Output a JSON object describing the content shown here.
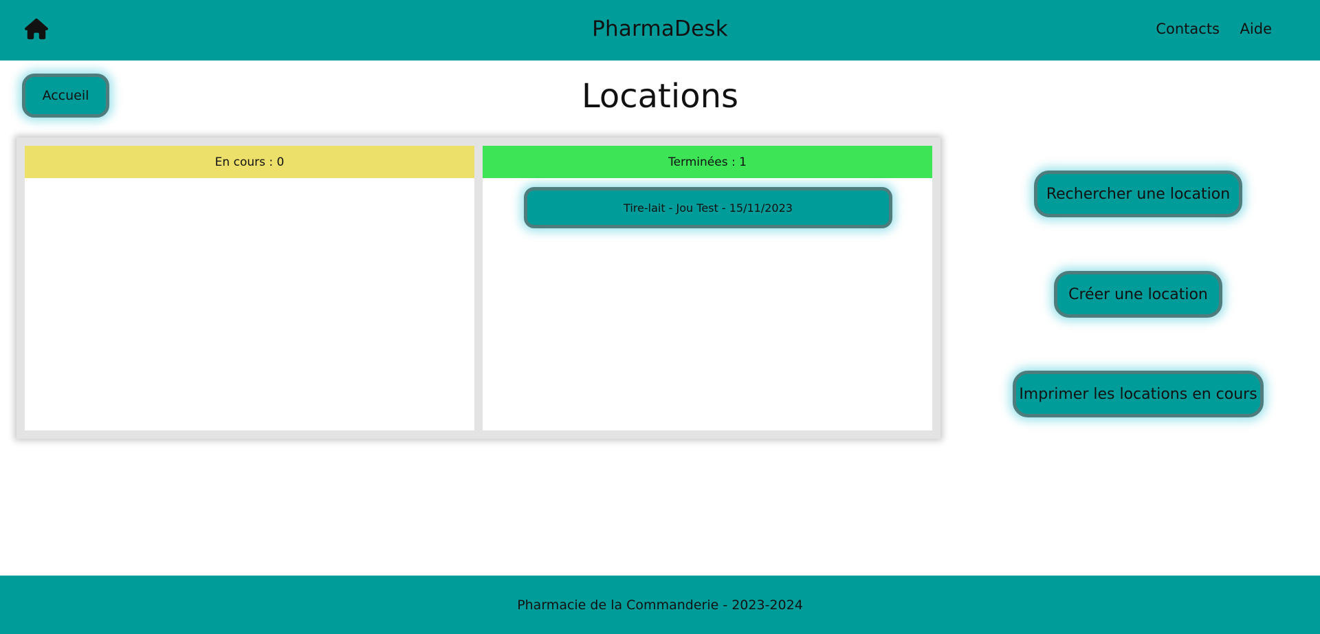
{
  "navbar": {
    "brand": "PharmaDesk",
    "home_icon": "home-icon",
    "links": [
      "Contacts",
      "Aide"
    ]
  },
  "accueil_button": "Accueil",
  "page_title": "Locations",
  "columns": {
    "en_cours": {
      "label": "En cours : 0",
      "color": "#ede06a",
      "items": []
    },
    "terminees": {
      "label": "Terminées : 1",
      "color": "#3de456",
      "items": [
        "Tire-lait - Jou Test - 15/11/2023"
      ]
    }
  },
  "actions": {
    "search": "Rechercher une location",
    "create": "Créer une location",
    "print": "Imprimer les locations en cours"
  },
  "footer": {
    "text": "Pharmacie de la Commanderie - 2023-2024"
  },
  "colors": {
    "primary": "#009c9a",
    "button_border": "#4f7c7d",
    "board_background": "#e3e3e3"
  }
}
